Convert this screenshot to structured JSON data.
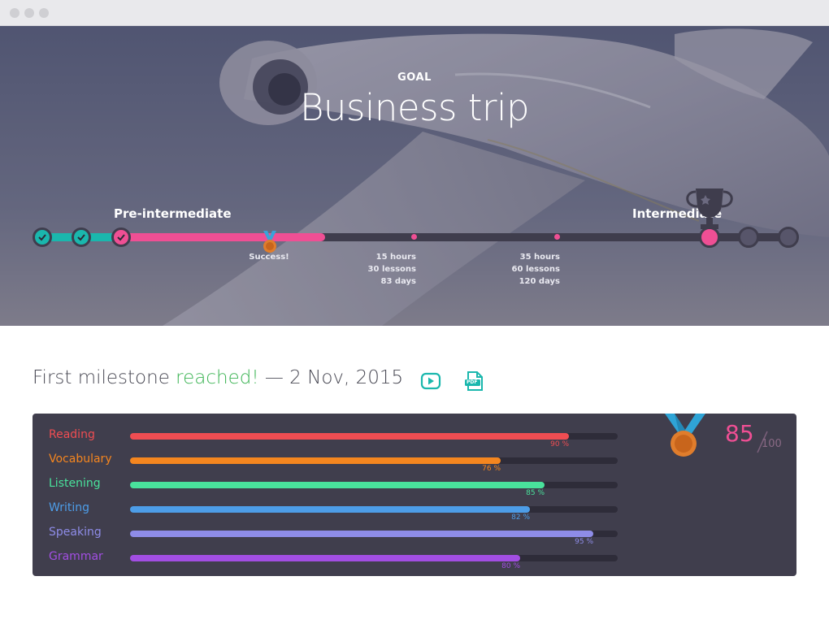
{
  "hero": {
    "goal_label": "GOAL",
    "goal_title": "Business trip",
    "level_start": "Pre-intermediate",
    "level_end": "Intermediate",
    "success_label": "Success!",
    "stat_a": [
      "15 hours",
      "30 lessons",
      "83 days"
    ],
    "stat_b": [
      "35 hours",
      "60 lessons",
      "120 days"
    ],
    "progress_fraction": 0.38
  },
  "milestone": {
    "prefix": "First milestone ",
    "accent": "reached!",
    "suffix": " — 2 Nov, 2015",
    "video_icon": "play-video-icon",
    "pdf_icon": "pdf-download-icon",
    "pdf_badge": "PDF"
  },
  "skills": [
    {
      "name": "Reading",
      "value": 90,
      "label": "90 %",
      "color": "#ef4d52"
    },
    {
      "name": "Vocabulary",
      "value": 76,
      "label": "76 %",
      "color": "#f5861f"
    },
    {
      "name": "Listening",
      "value": 85,
      "label": "85 %",
      "color": "#49e29c"
    },
    {
      "name": "Writing",
      "value": 82,
      "label": "82 %",
      "color": "#4d9de8"
    },
    {
      "name": "Speaking",
      "value": 95,
      "label": "95 %",
      "color": "#8e8ce8"
    },
    {
      "name": "Grammar",
      "value": 80,
      "label": "80 %",
      "color": "#a24ee3"
    }
  ],
  "score": {
    "value": "85",
    "max": "100"
  },
  "colors": {
    "teal": "#1ab7ad",
    "pink": "#ef4f94",
    "panel": "#403e4d",
    "accent_green": "#3cb454"
  }
}
